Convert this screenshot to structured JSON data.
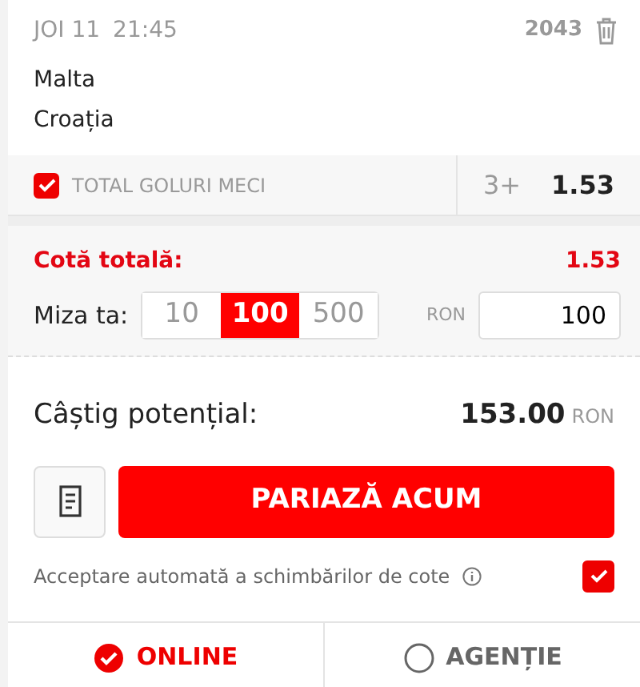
{
  "event": {
    "day": "JOI 11",
    "time": "21:45",
    "code": "2043",
    "teams": [
      "Malta",
      "Croația"
    ]
  },
  "selection": {
    "checked": true,
    "market": "TOTAL GOLURI MECI",
    "outcome": "3+",
    "odds": "1.53"
  },
  "total_odds": {
    "label": "Cotă totală:",
    "value": "1.53"
  },
  "stake": {
    "label": "Miza ta:",
    "presets": [
      {
        "label": "10",
        "selected": false
      },
      {
        "label": "100",
        "selected": true
      },
      {
        "label": "500",
        "selected": false
      }
    ],
    "currency": "RON",
    "value": "100"
  },
  "potential_win": {
    "label": "Câștig potențial:",
    "value": "153.00",
    "currency": "RON"
  },
  "place_bet": "PARIAZĂ ACUM",
  "auto_accept": {
    "label": "Acceptare automată a schimbărilor de cote",
    "checked": true
  },
  "channels": [
    {
      "label": "ONLINE",
      "selected": true
    },
    {
      "label": "AGENȚIE",
      "selected": false
    }
  ]
}
